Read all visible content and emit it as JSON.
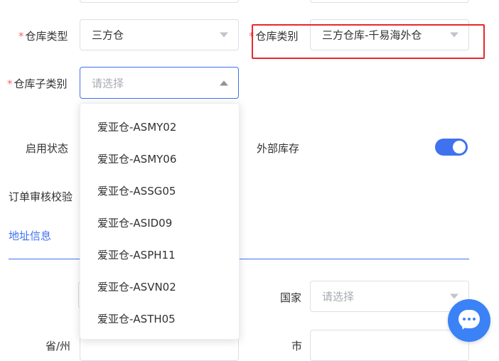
{
  "form": {
    "warehouse_type": {
      "label": "仓库类型",
      "value": "三方仓"
    },
    "warehouse_category": {
      "label": "仓库类别",
      "value": "三方仓库-千易海外仓"
    },
    "warehouse_subcategory": {
      "label": "仓库子类别",
      "placeholder": "请选择"
    },
    "enable_status": {
      "label": "启用状态"
    },
    "external_stock": {
      "label": "外部库存",
      "on": true
    },
    "order_review": {
      "label": "订单审核校验"
    }
  },
  "address": {
    "section_title": "地址信息",
    "country": {
      "label": "国家",
      "placeholder": "请选择"
    },
    "province": {
      "label": "省/州"
    },
    "city": {
      "label": "市"
    }
  },
  "dropdown": {
    "options": [
      "爱亚仓-ASMY02",
      "爱亚仓-ASMY06",
      "爱亚仓-ASSG05",
      "爱亚仓-ASID09",
      "爱亚仓-ASPH11",
      "爱亚仓-ASVN02",
      "爱亚仓-ASTH05"
    ]
  },
  "colors": {
    "accent": "#4072f0",
    "required": "#f56c6c",
    "highlight": "#e8282c"
  },
  "icons": {
    "chat": "chat-bubble-icon",
    "caret": "caret-icon"
  }
}
